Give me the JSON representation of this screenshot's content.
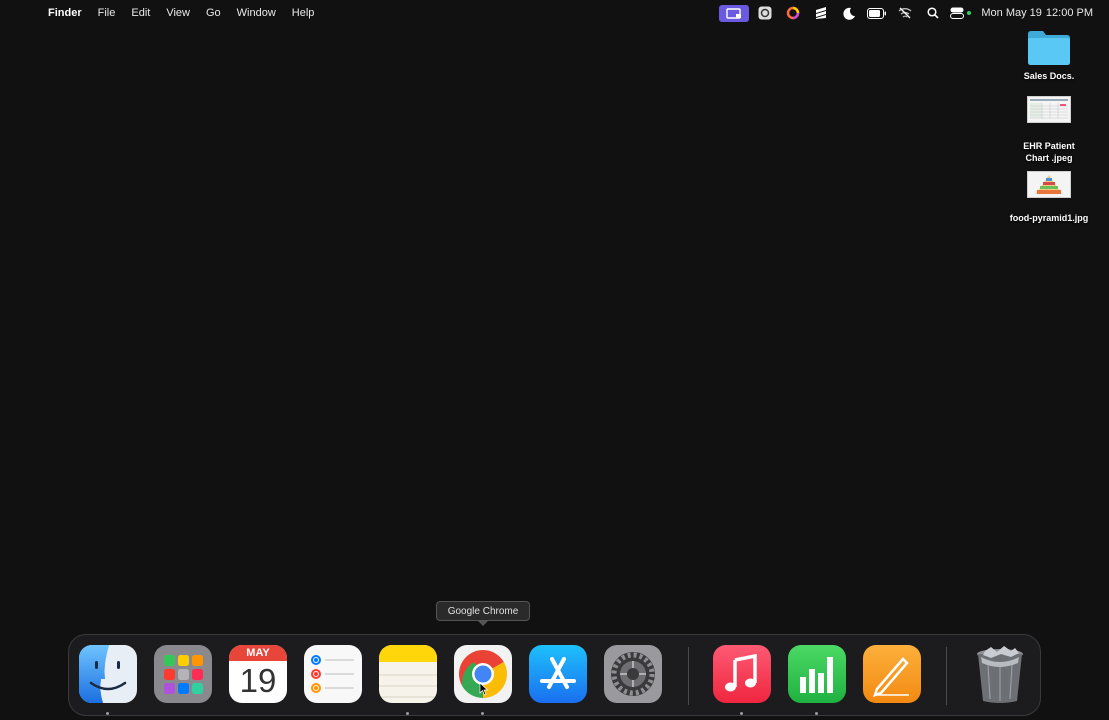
{
  "menubar": {
    "apple_glyph": "",
    "items": [
      "Finder",
      "File",
      "Edit",
      "View",
      "Go",
      "Window",
      "Help"
    ],
    "status_icons": [
      "screen-share-icon",
      "settings-app-icon",
      "color-ring-icon",
      "stack-icon",
      "moon-icon",
      "battery-icon",
      "wifi-off-icon",
      "search-icon",
      "control-center-icon"
    ],
    "clock": {
      "date": "Mon May 19",
      "time": "12:00 PM"
    }
  },
  "desktop": {
    "icons": [
      {
        "label": "Sales Docs.",
        "icon": "folder-icon"
      },
      {
        "label_line1": "EHR Patient",
        "label_line2": "Chart .jpeg",
        "icon": "spreadsheet-thumbnail-icon"
      },
      {
        "label": "food-pyramid1.jpg",
        "icon": "pyramid-thumbnail-icon"
      }
    ]
  },
  "tooltip": {
    "text": "Google Chrome"
  },
  "dock": {
    "apps": [
      {
        "name": "Finder",
        "running": true
      },
      {
        "name": "Launchpad",
        "running": false
      },
      {
        "name": "Calendar",
        "running": false,
        "month": "MAY",
        "day": "19"
      },
      {
        "name": "Reminders",
        "running": false
      },
      {
        "name": "Notes",
        "running": true
      },
      {
        "name": "Google Chrome",
        "running": true
      },
      {
        "name": "App Store",
        "running": false
      },
      {
        "name": "System Settings",
        "running": false
      },
      {
        "name": "Music",
        "running": true
      },
      {
        "name": "Numbers",
        "running": true
      },
      {
        "name": "Pages",
        "running": false
      },
      {
        "name": "Trash",
        "running": false
      }
    ]
  },
  "colors": {
    "desktop_bg": "#111111",
    "dock_bg": "#1c1c1e",
    "calendar_red": "#e8463a",
    "music_red": "#fb3e59",
    "numbers_green": "#2fc252",
    "pages_orange": "#f79b24",
    "folder_blue": "#5ac8f5"
  }
}
